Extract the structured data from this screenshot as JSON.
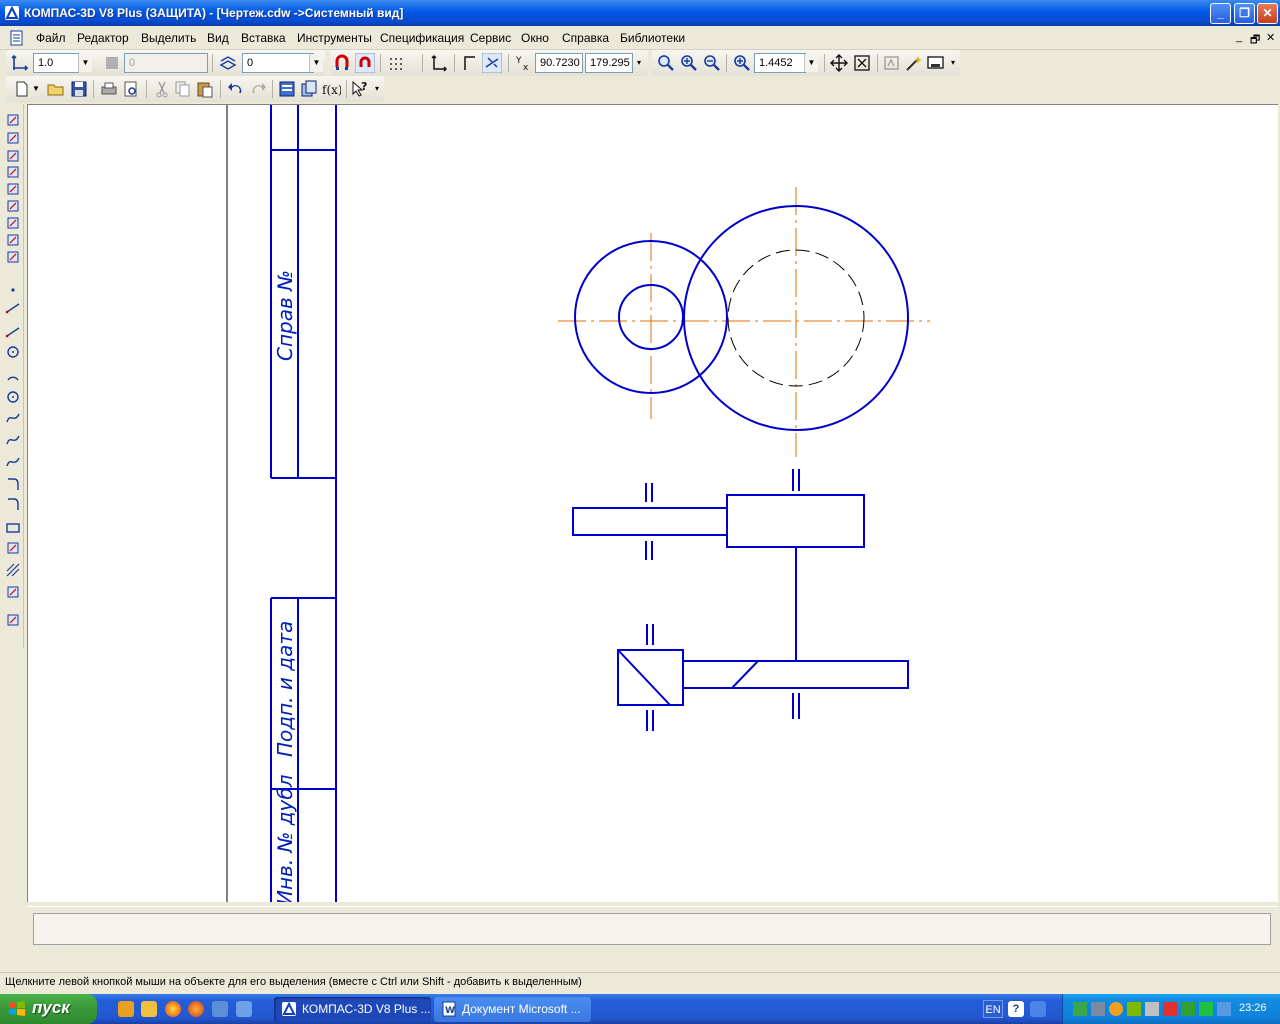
{
  "window": {
    "title": "КОМПАС-3D V8 Plus (ЗАЩИТА) - [Чертеж.cdw ->Системный вид]",
    "controls": {
      "minimize": "_",
      "maximize": "❐",
      "close": "✕"
    }
  },
  "menu": {
    "items": [
      "Файл",
      "Редактор",
      "Выделить",
      "Вид",
      "Вставка",
      "Инструменты",
      "Спецификация",
      "Сервис",
      "Окно",
      "Справка",
      "Библиотеки"
    ],
    "mdi_controls": {
      "minimize": "_",
      "restore": "🗗",
      "close": "✕"
    }
  },
  "toolbar_current": {
    "step_value": "1.0",
    "layer_value": "0",
    "style_value": "0",
    "coord_x": "90.7230",
    "coord_y": "179.295",
    "zoom_value": "1.4452"
  },
  "drawing": {
    "stamp_labels": {
      "sprav": "Справ №",
      "podp": "Подп. и дата",
      "inv": "Инв. № дубл"
    },
    "colors": {
      "line": "#0000cc",
      "axis": "#e07000",
      "hidden": "#000000"
    }
  },
  "statusbar": {
    "hint": "Щелкните левой кнопкой мыши на объекте для его выделения (вместе с Ctrl или Shift - добавить к выделенным)"
  },
  "taskbar": {
    "start_label": "пуск",
    "tasks": [
      {
        "label": "КОМПАС-3D V8 Plus ...",
        "state": "active"
      },
      {
        "label": "Документ Microsoft ...",
        "state": "inactive"
      }
    ],
    "language": "EN",
    "clock": "23:26"
  }
}
